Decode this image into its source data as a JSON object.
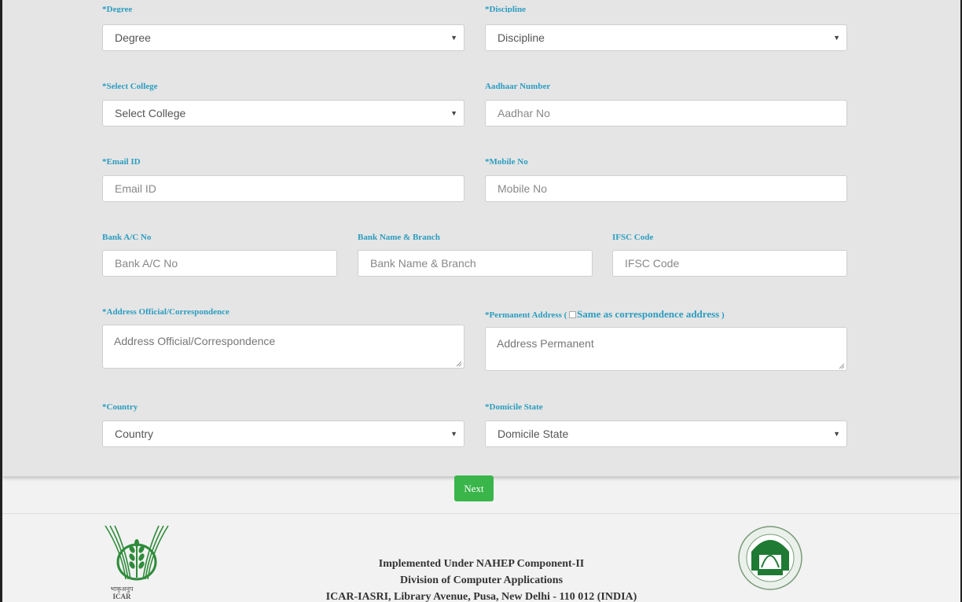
{
  "form": {
    "degree": {
      "label": "*Degree",
      "value": "Degree"
    },
    "discipline": {
      "label": "*Discipline",
      "value": "Discipline"
    },
    "college": {
      "label": "*Select College",
      "value": "Select College"
    },
    "aadhaar": {
      "label": "Aadhaar Number",
      "placeholder": "Aadhar No"
    },
    "email": {
      "label": "*Email ID",
      "placeholder": "Email ID"
    },
    "mobile": {
      "label": "*Mobile No",
      "placeholder": "Mobile No"
    },
    "bank_ac": {
      "label": "Bank A/C No",
      "placeholder": "Bank A/C No"
    },
    "bank_name": {
      "label": "Bank Name & Branch",
      "placeholder": "Bank Name & Branch"
    },
    "ifsc": {
      "label": "IFSC Code",
      "placeholder": "IFSC Code"
    },
    "address_official": {
      "label": "*Address Official/Correspondence",
      "placeholder": "Address Official/Correspondence"
    },
    "address_permanent": {
      "label": "*Permanent Address (",
      "same_label": "Same as correspondence address",
      "close_paren": ")",
      "placeholder": "Address Permanent"
    },
    "country": {
      "label": "*Country",
      "value": "Country"
    },
    "domicile": {
      "label": "*Domicile State",
      "value": "Domicile State"
    },
    "select_caret": "▼"
  },
  "next_button": "Next",
  "footer": {
    "line1": "Implemented Under NAHEP Component-II",
    "line2": "Division of Computer Applications",
    "line3": "ICAR-IASRI, Library Avenue, Pusa, New Delhi - 110 012 (INDIA)",
    "icar_logo_text": "ICAR",
    "icar_logo_hindi": "भाकृअनुप"
  },
  "colors": {
    "label": "#2b9dc0",
    "button": "#3ab54a",
    "panel": "#e5e5e5",
    "icar_green": "#2e8b3a"
  }
}
